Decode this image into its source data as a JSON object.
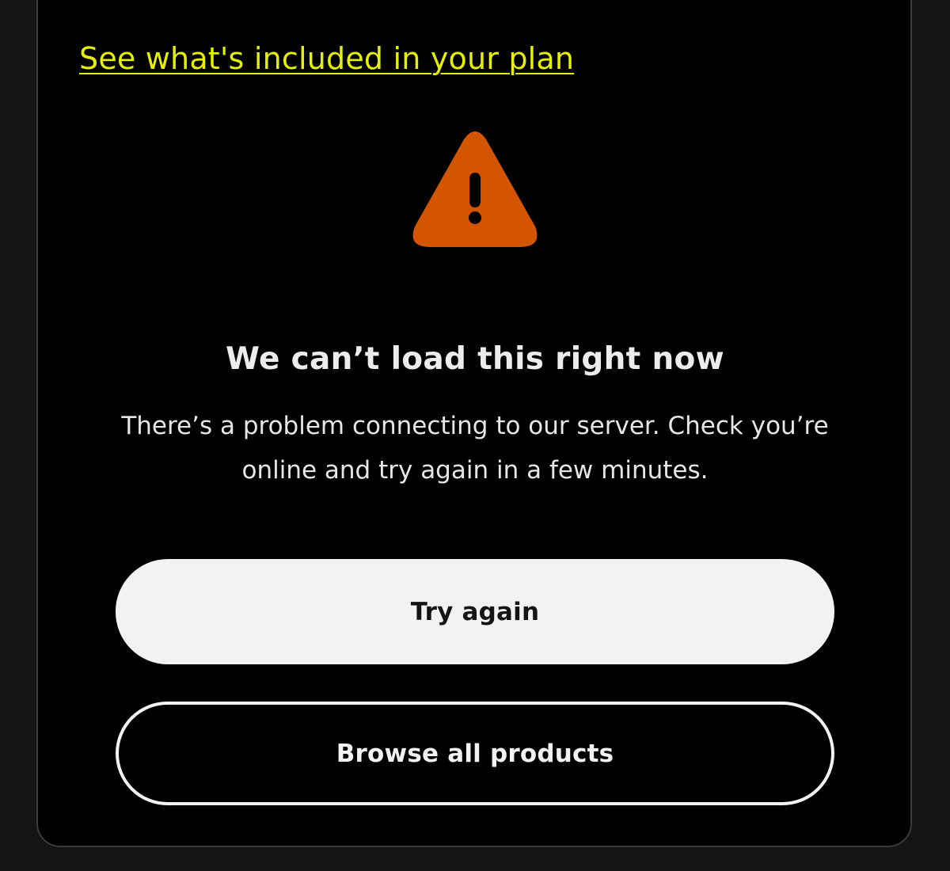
{
  "plan_link": {
    "label": "See what's included in your plan",
    "color": "#e6f000"
  },
  "error": {
    "icon": "warning-triangle-icon",
    "icon_color": "#d45500",
    "title": "We can’t load this right now",
    "message": "There’s a problem connecting to our server. Check you’re online and try again in a few minutes."
  },
  "actions": {
    "primary_label": "Try again",
    "secondary_label": "Browse all products"
  }
}
